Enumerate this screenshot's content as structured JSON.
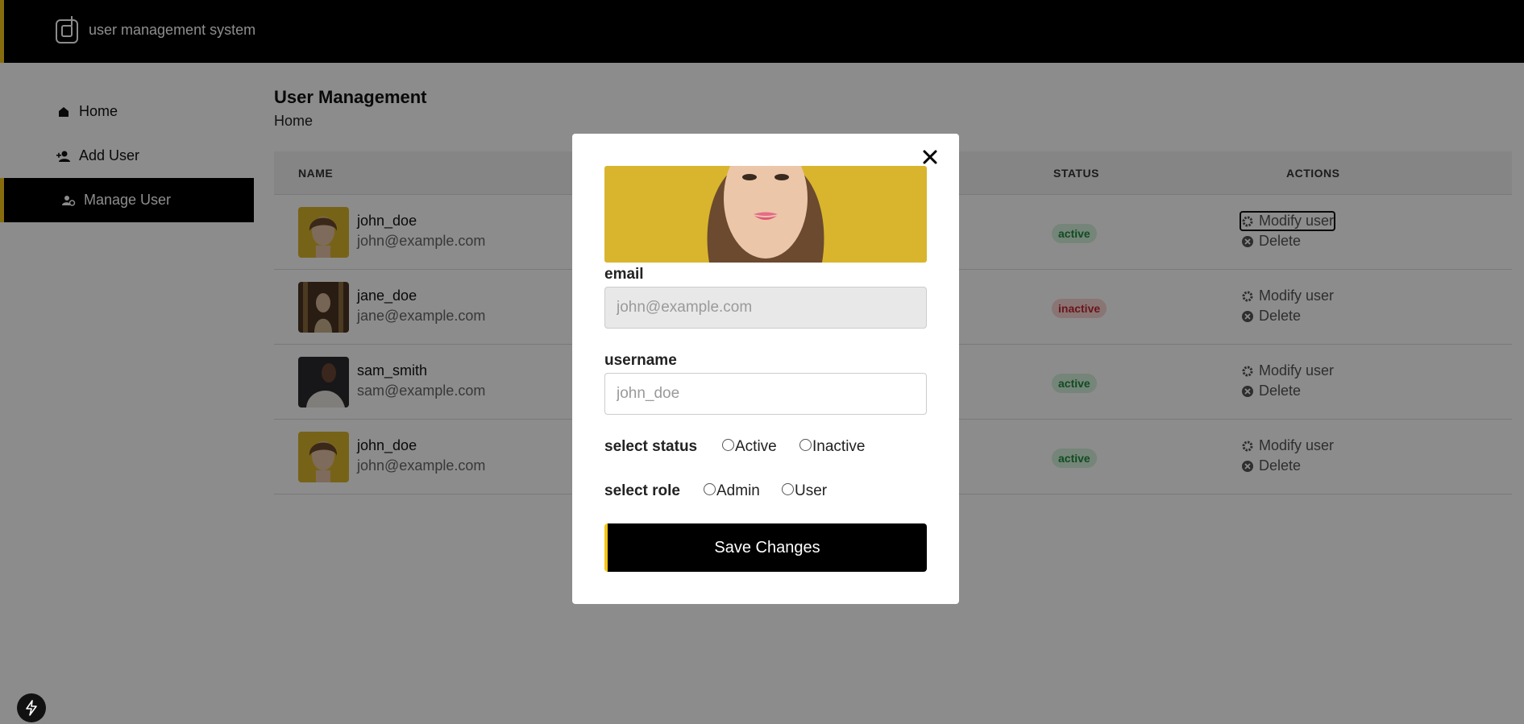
{
  "app": {
    "title": "user management system"
  },
  "sidebar": {
    "items": [
      {
        "label": "Home",
        "icon": "home-icon"
      },
      {
        "label": "Add User",
        "icon": "add-user-icon"
      },
      {
        "label": "Manage User",
        "icon": "manage-user-icon",
        "active": true
      }
    ]
  },
  "main": {
    "title": "User Management",
    "breadcrumb": "Home",
    "table": {
      "headers": {
        "name": "NAME",
        "status": "STATUS",
        "actions": "ACTIONS"
      },
      "rows": [
        {
          "username": "john_doe",
          "email": "john@example.com",
          "status": "active",
          "avatar": "woman-yellow-bg"
        },
        {
          "username": "jane_doe",
          "email": "jane@example.com",
          "status": "inactive",
          "avatar": "woman-dark-bg"
        },
        {
          "username": "sam_smith",
          "email": "sam@example.com",
          "status": "active",
          "avatar": "man-dark-bg"
        },
        {
          "username": "john_doe",
          "email": "john@example.com",
          "status": "active",
          "avatar": "woman-yellow-bg"
        }
      ],
      "actions": {
        "modify": "Modify user",
        "delete": "Delete"
      }
    }
  },
  "modal": {
    "email_label": "email",
    "email_placeholder": "john@example.com",
    "username_label": "username",
    "username_placeholder": "john_doe",
    "status_label": "select status",
    "status_options": [
      "Active",
      "Inactive"
    ],
    "role_label": "select role",
    "role_options": [
      "Admin",
      "User"
    ],
    "save_label": "Save Changes"
  },
  "colors": {
    "accent": "#f5c518",
    "active_badge": "#1f8a3b",
    "inactive_badge": "#c0282e"
  }
}
